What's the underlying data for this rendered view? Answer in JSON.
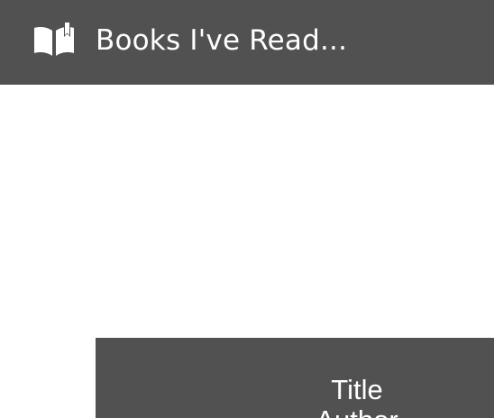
{
  "header": {
    "icon": "open-book-icon",
    "title": "Books I've Read..."
  },
  "book_card": {
    "title_label": "Title",
    "author_label": "Author"
  },
  "colors": {
    "header_bg": "#515151",
    "card_bg": "#515151",
    "text": "#ffffff",
    "page_bg": "#ffffff"
  }
}
